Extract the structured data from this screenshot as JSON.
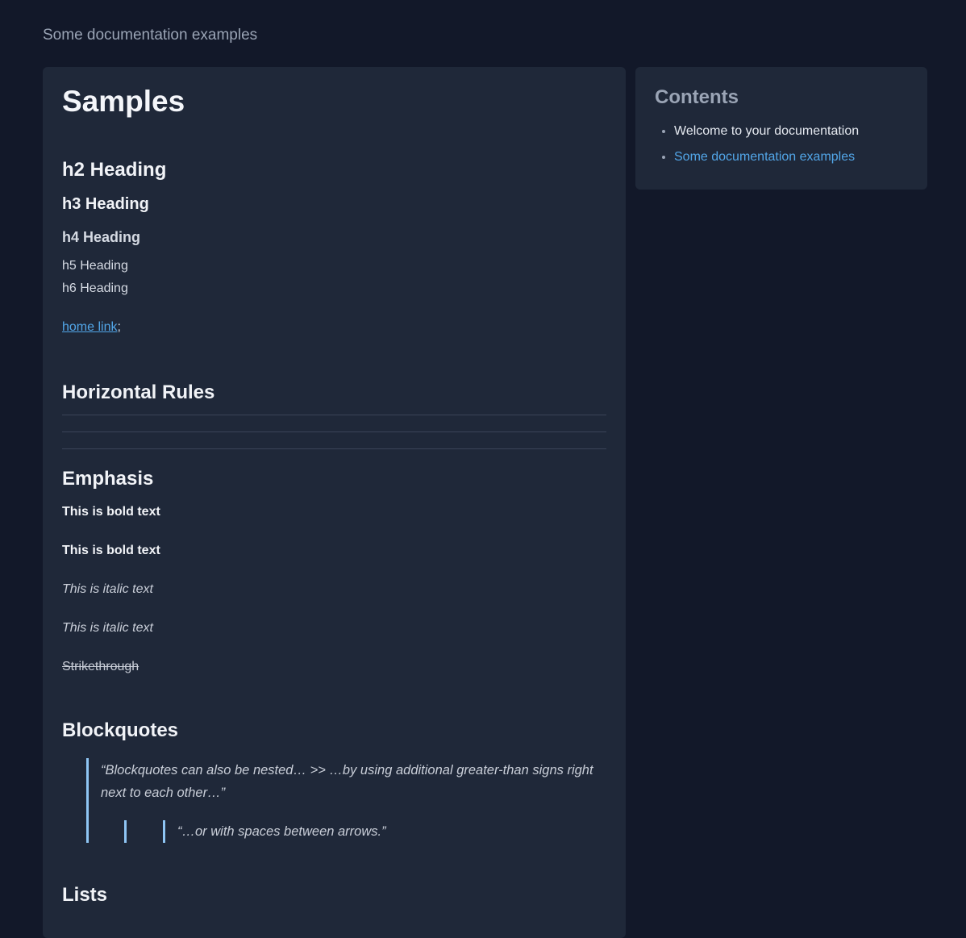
{
  "breadcrumb": "Some documentation examples",
  "main": {
    "title": "Samples",
    "headings": {
      "h2": "h2 Heading",
      "h3": "h3 Heading",
      "h4": "h4 Heading",
      "h5": "h5 Heading",
      "h6": "h6 Heading"
    },
    "home_link": "home link",
    "home_link_suffix": ";",
    "horizontal_rules_title": "Horizontal Rules",
    "emphasis_title": "Emphasis",
    "emphasis": {
      "bold_1": "This is bold text",
      "bold_2": "This is bold text",
      "italic_1": "This is italic text",
      "italic_2": "This is italic text",
      "strikethrough": "Strikethrough"
    },
    "blockquotes_title": "Blockquotes",
    "blockquote_text": "“Blockquotes can also be nested… >> …by using additional greater-than signs right next to each other…”",
    "blockquote_nested_text": "“…or with spaces between arrows.”",
    "lists_title": "Lists"
  },
  "sidebar": {
    "title": "Contents",
    "items": [
      {
        "label": "Welcome to your documentation",
        "link": false
      },
      {
        "label": "Some documentation examples",
        "link": true
      }
    ]
  },
  "colors": {
    "background": "#121829",
    "card": "#1f2839",
    "link": "#52a6e8",
    "quote_bar": "#8ec5f4"
  }
}
